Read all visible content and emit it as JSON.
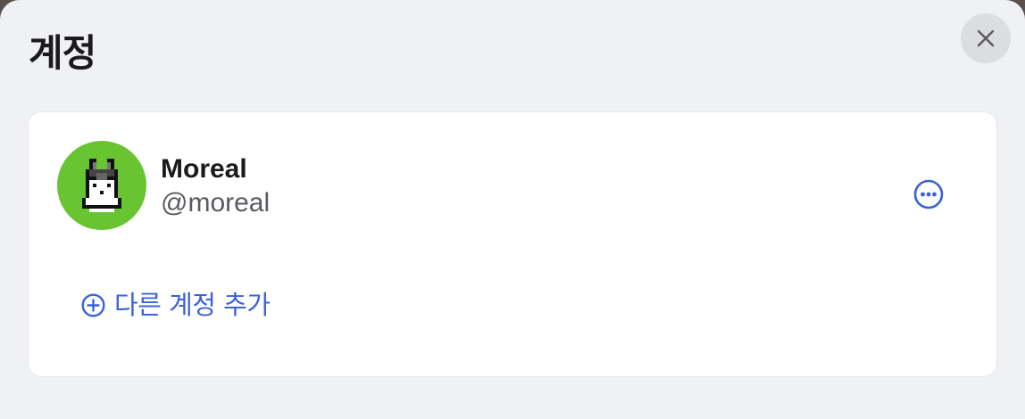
{
  "header": {
    "title": "계정"
  },
  "account": {
    "display_name": "Moreal",
    "handle": "@moreal",
    "avatar_color": "#68c431"
  },
  "actions": {
    "add_account_label": "다른 계정 추가",
    "accent_color": "#3a63d8"
  },
  "icons": {
    "close": "close-icon",
    "more": "more-horizontal-circle-icon",
    "add": "plus-circle-icon"
  }
}
